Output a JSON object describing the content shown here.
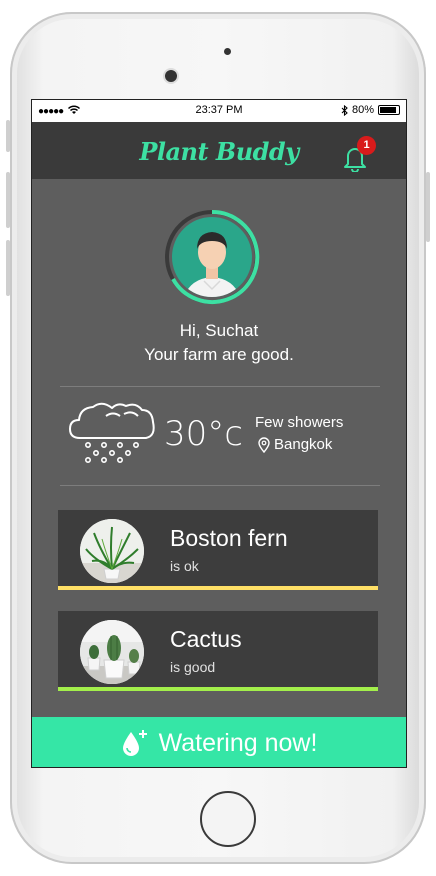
{
  "status_bar": {
    "signal": "●●●●●",
    "time": "23:37 PM",
    "bluetooth_icon": "bluetooth-icon",
    "battery": "80%"
  },
  "header": {
    "app_name": "Plant Buddy",
    "notification_count": "1"
  },
  "profile": {
    "greeting": "Hi, Suchat",
    "message": "Your farm are good."
  },
  "weather": {
    "icon": "cloud-rain-icon",
    "temperature": "30°c",
    "condition": "Few showers",
    "location": "Bangkok"
  },
  "plants": [
    {
      "name": "Boston fern",
      "status": "is ok",
      "status_color": "#ffe066"
    },
    {
      "name": "Cactus",
      "status": "is good",
      "status_color": "#a3ef4b"
    }
  ],
  "action": {
    "label": "Watering now!"
  },
  "colors": {
    "accent": "#35e6a6",
    "logo": "#3de0a3",
    "background": "#5e5e5e",
    "navbar": "#3a3a3a",
    "badge": "#d81b1b"
  }
}
